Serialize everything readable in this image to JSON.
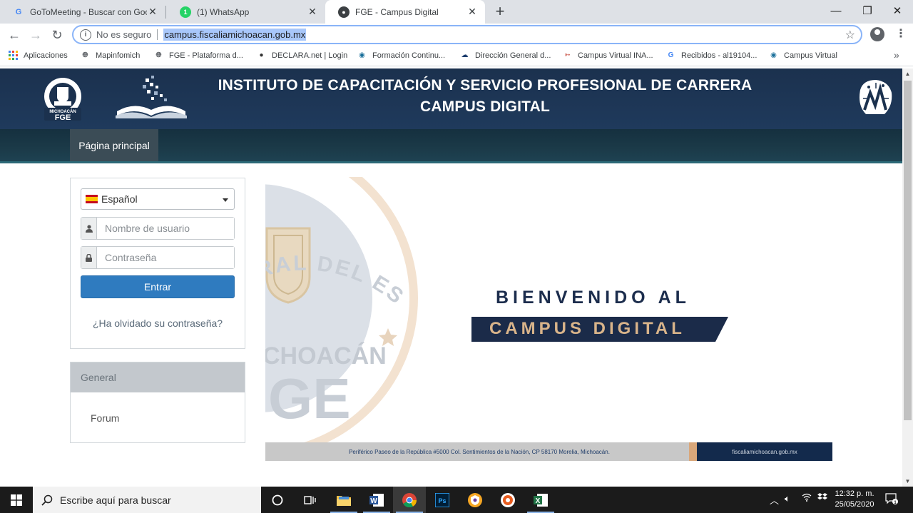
{
  "browser": {
    "tabs": [
      {
        "title": "GoToMeeting - Buscar con Google",
        "favicon": "google-icon"
      },
      {
        "title": "(1) WhatsApp",
        "favicon": "whatsapp-icon"
      },
      {
        "title": "FGE - Campus Digital",
        "favicon": "moodle-icon",
        "active": true
      }
    ],
    "address": {
      "security": "No es seguro",
      "url": "campus.fiscaliamichoacan.gob.mx"
    },
    "bookmarks": [
      {
        "label": "Aplicaciones",
        "icon": "apps-grid-icon"
      },
      {
        "label": "Mapinfomich",
        "icon": "globe-icon"
      },
      {
        "label": "FGE - Plataforma d...",
        "icon": "globe-icon"
      },
      {
        "label": "DECLARA.net | Login",
        "icon": "declara-icon"
      },
      {
        "label": "Formación Continu...",
        "icon": "moodle-icon"
      },
      {
        "label": "Dirección General d...",
        "icon": "cloud-icon"
      },
      {
        "label": "Campus Virtual INA...",
        "icon": "arrow-logo-icon"
      },
      {
        "label": "Recibidos - al19104...",
        "icon": "google-icon"
      },
      {
        "label": "Campus Virtual",
        "icon": "moodle-icon"
      }
    ]
  },
  "site": {
    "header_line1": "INSTITUTO DE CAPACITACIÓN Y SERVICIO  PROFESIONAL DE CARRERA",
    "header_line2": "CAMPUS DIGITAL",
    "logo_text": "FGE",
    "logo_subtext": "MICHOACÁN",
    "nav": {
      "home": "Página principal"
    }
  },
  "login": {
    "language": "Español",
    "username_placeholder": "Nombre de usuario",
    "password_placeholder": "Contraseña",
    "submit": "Entrar",
    "forgot": "¿Ha olvidado su contraseña?"
  },
  "general": {
    "title": "General",
    "forum": "Forum"
  },
  "banner": {
    "welcome_line1": "BIENVENIDO AL",
    "welcome_line2": "CAMPUS DIGITAL",
    "watermark_arc": "ERAL DEL ESTADO",
    "watermark_state": "CHOACÁN",
    "watermark_fge": "GE",
    "address": "Periférico Paseo de la República #5000 Col. Sentimientos de la Nación, CP 58170 Morelia, Michoacán.",
    "website": "fiscaliamichoacan.gob.mx"
  },
  "taskbar": {
    "search_placeholder": "Escribe aquí para buscar",
    "time": "12:32 p. m.",
    "date": "25/05/2020"
  },
  "colors": {
    "header_bg": "#1b314e",
    "nav_bg": "#1b3a48",
    "nav_accent": "#2d6a78",
    "button_blue": "#2f7bbf",
    "banner_navy": "#1b2b49",
    "banner_gold": "#d9b48a"
  }
}
